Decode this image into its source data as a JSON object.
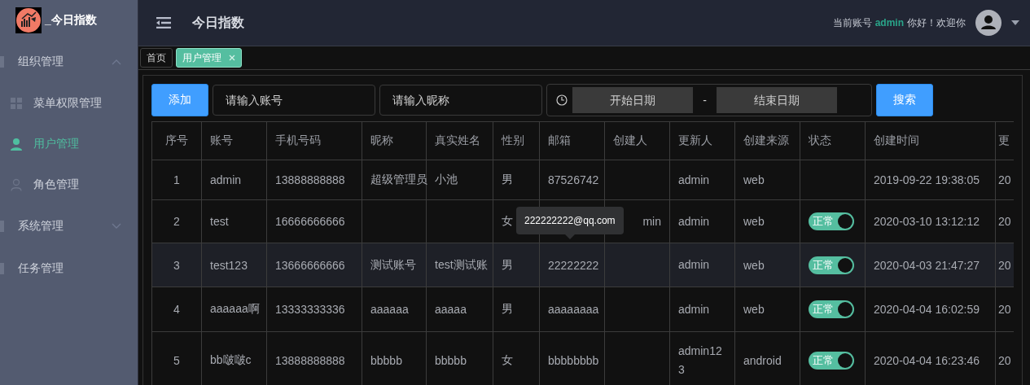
{
  "logo": {
    "text": "_今日指数"
  },
  "sidebar": {
    "items": [
      {
        "label": "组织管理",
        "expanded": true,
        "selected": false,
        "children": [
          {
            "label": "菜单权限管理",
            "selected": false
          },
          {
            "label": "用户管理",
            "selected": true
          },
          {
            "label": "角色管理",
            "selected": false
          }
        ]
      },
      {
        "label": "系统管理",
        "expanded": false,
        "selected": false
      },
      {
        "label": "任务管理",
        "selected": false
      }
    ]
  },
  "header": {
    "title": "今日指数",
    "greeting_prefix": "当前账号",
    "user": "admin",
    "greeting_suffix": "你好！欢迎你"
  },
  "tabs": [
    {
      "label": "首页",
      "selected": false,
      "closable": false
    },
    {
      "label": "用户管理",
      "selected": true,
      "closable": true
    }
  ],
  "toolbar": {
    "add_button": "添加",
    "account_field": {
      "placeholder": "请输入账号"
    },
    "nickname_field": {
      "placeholder": "请输入昵称"
    },
    "start_date": {
      "placeholder": "开始日期"
    },
    "separator": "-",
    "end_date": {
      "placeholder": "结束日期"
    },
    "search_button": "搜索"
  },
  "table": {
    "columns": [
      "序号",
      "账号",
      "手机号码",
      "昵称",
      "真实姓名",
      "性别",
      "邮箱",
      "创建人",
      "更新人",
      "创建来源",
      "状态",
      "创建时间",
      "更"
    ],
    "rows": [
      {
        "highlighted": false,
        "cells": [
          "1",
          "admin",
          "13888888888",
          "超级管理员",
          "小池",
          "男",
          "87526742",
          null,
          "admin",
          "web",
          null,
          "2019-09-22 19:38:05",
          "20"
        ]
      },
      {
        "highlighted": false,
        "cells": [
          "2",
          "test",
          "16666666666",
          null,
          null,
          "女",
          null,
          "min",
          "admin",
          "web",
          {
            "kind": "switch",
            "label": "正常",
            "on": true
          },
          "2020-03-10 13:12:12",
          "20"
        ]
      },
      {
        "highlighted": true,
        "cells": [
          "3",
          "test123",
          "13666666666",
          "测试账号",
          "test测试账",
          "男",
          "22222222",
          null,
          "admin",
          "web",
          {
            "kind": "switch",
            "label": "正常",
            "on": true
          },
          "2020-04-03 21:47:27",
          "20"
        ]
      },
      {
        "highlighted": false,
        "cells": [
          "4",
          "aaaaaa啊",
          "13333333336",
          "aaaaaa",
          "aaaaa",
          "男",
          "aaaaaaaa",
          null,
          "admin",
          "web",
          {
            "kind": "switch",
            "label": "正常",
            "on": true
          },
          "2020-04-04 16:02:59",
          "20"
        ]
      },
      {
        "highlighted": false,
        "cells": [
          "5",
          "bb啵啵c",
          "13888888888",
          "bbbbb",
          "bbbbb",
          "女",
          "bbbbbbbb",
          null,
          "admin123",
          "android",
          {
            "kind": "switch",
            "label": "正常",
            "on": true
          },
          "2020-04-04 16:23:46",
          "20"
        ]
      }
    ],
    "tooltip": {
      "text": "222222222@qq.com"
    }
  }
}
